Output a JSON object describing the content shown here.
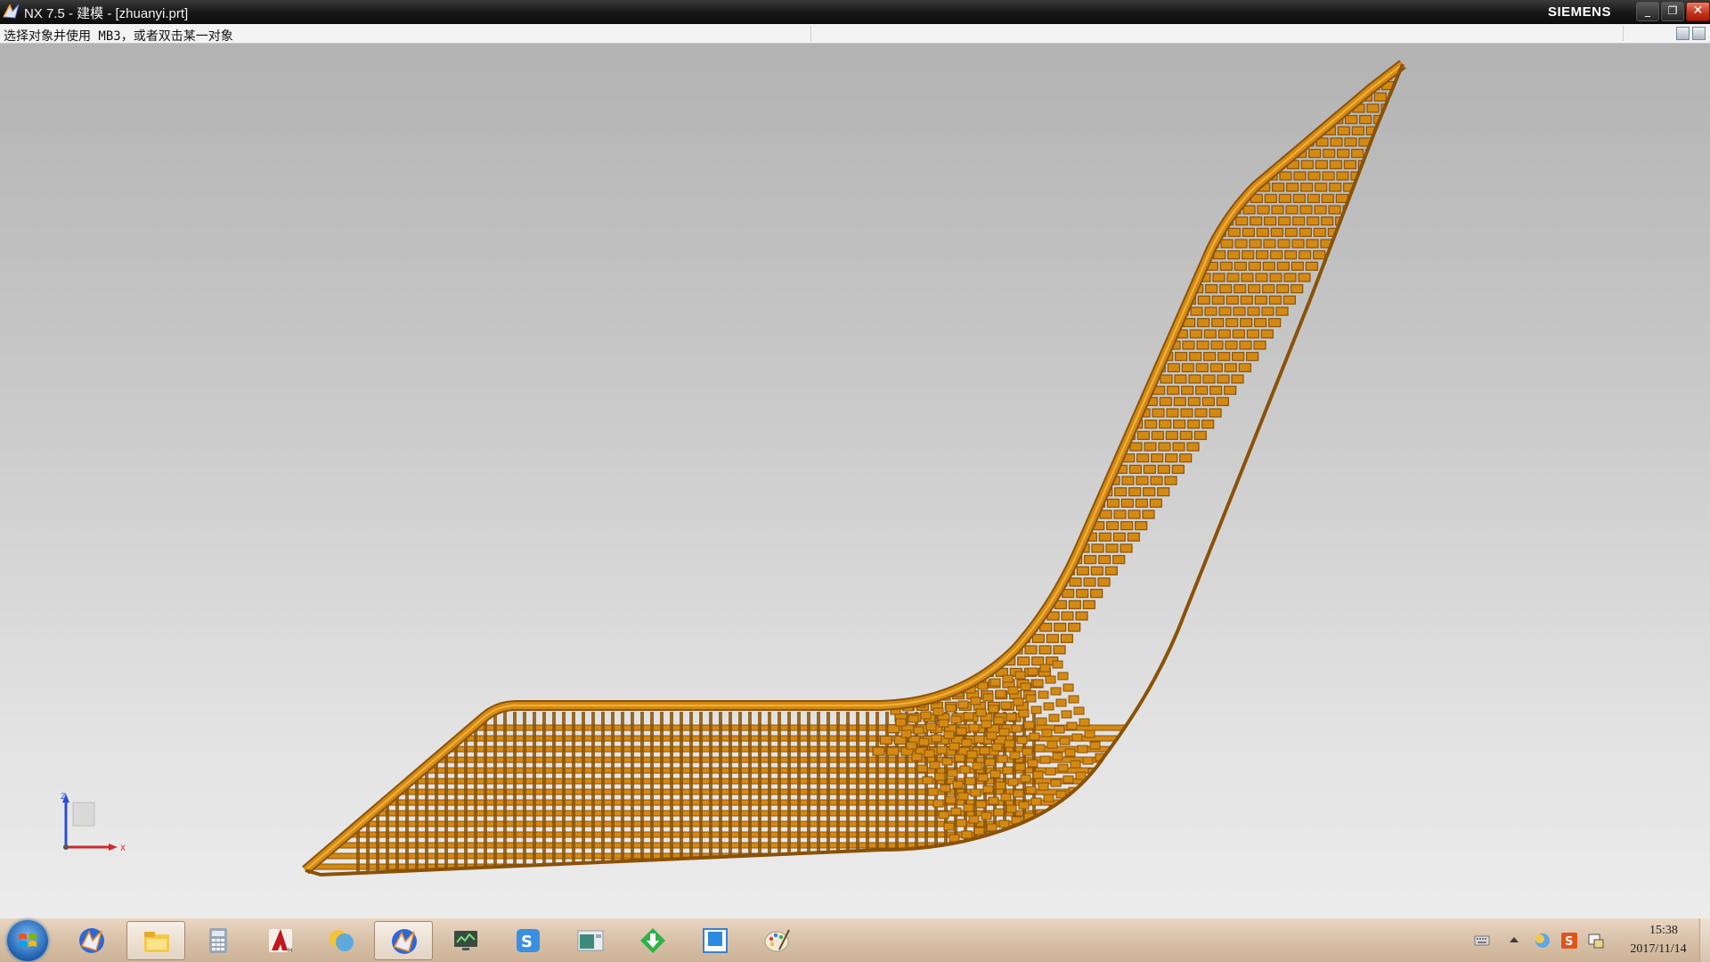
{
  "window": {
    "title": "NX 7.5 - 建模 - [zhuanyi.prt]",
    "brand": "SIEMENS",
    "minimize_glyph": "_",
    "maximize_glyph": "❐",
    "close_glyph": "✕"
  },
  "cue_line": {
    "text": "选择对象并使用 MB3，或者双击某一对象"
  },
  "viewport": {
    "model_color": "#d48a12",
    "model_shadow_color": "#8a5208",
    "triad": {
      "z_label": "Z",
      "x_label": "X",
      "z_color": "#2b4fd6",
      "x_color": "#d02a2a"
    }
  },
  "taskbar": {
    "start_icon": "windows-start-orb",
    "items": [
      {
        "icon": "nx-launcher-icon",
        "active": false
      },
      {
        "icon": "file-explorer-icon",
        "active": true
      },
      {
        "icon": "calculator-icon",
        "active": false
      },
      {
        "icon": "autocad-icon",
        "active": false
      },
      {
        "icon": "messenger-icon",
        "active": false
      },
      {
        "icon": "nx-app-icon",
        "active": true
      },
      {
        "icon": "monitor-app-icon",
        "active": false
      },
      {
        "icon": "input-method-icon",
        "active": false
      },
      {
        "icon": "window-app-icon",
        "active": false
      },
      {
        "icon": "download-arrow-icon",
        "active": false
      },
      {
        "icon": "blue-square-app-icon",
        "active": false
      },
      {
        "icon": "paint-palette-icon",
        "active": false
      }
    ],
    "tray": {
      "icons": [
        "keyboard-icon",
        "show-hidden-icons-arrow",
        "network-status-icon",
        "sogou-input-icon",
        "action-center-icon"
      ],
      "time": "15:38",
      "date": "2017/11/14"
    }
  }
}
